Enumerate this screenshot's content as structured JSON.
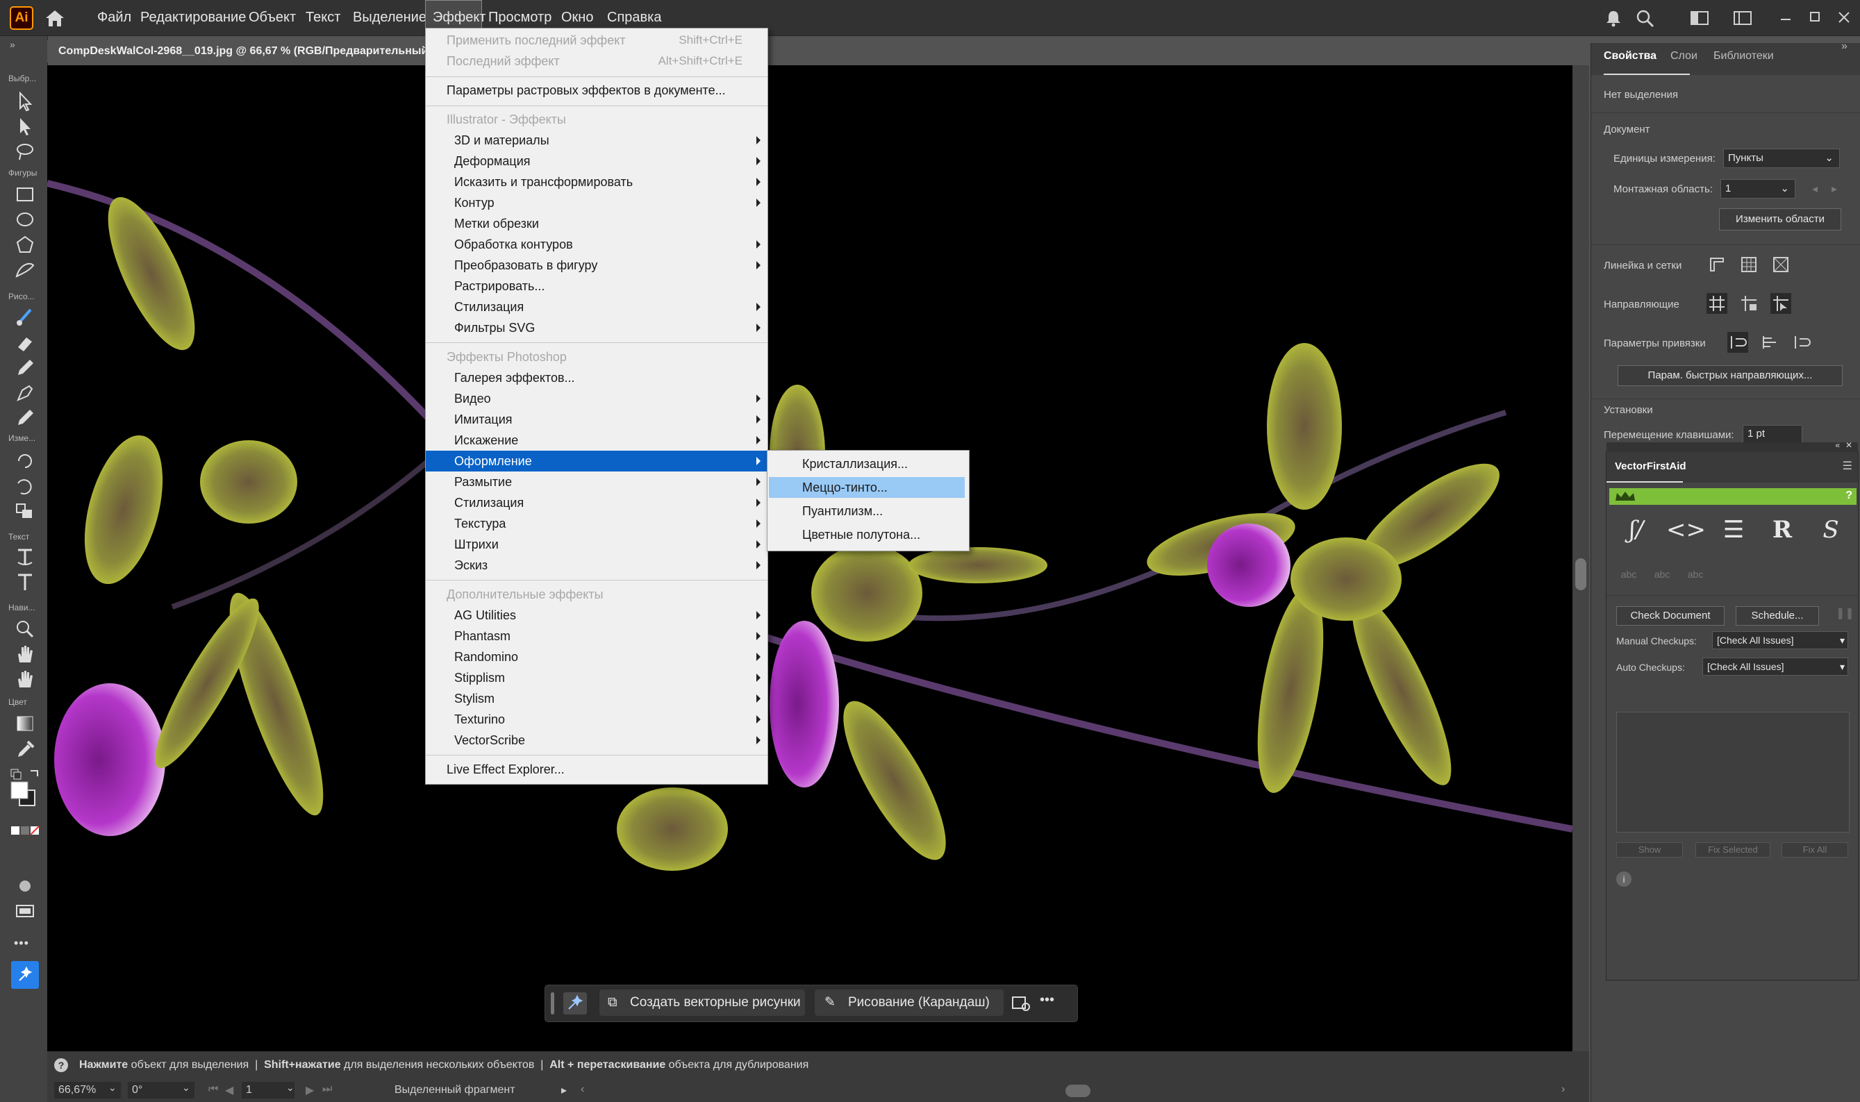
{
  "app": {
    "logo": "Ai"
  },
  "menubar": {
    "items": [
      "Файл",
      "Редактирование",
      "Объект",
      "Текст",
      "Выделение",
      "Эффект",
      "Просмотр",
      "Окно",
      "Справка"
    ]
  },
  "document": {
    "tab_title": "CompDeskWalCol-2968__019.jpg @ 66,67 % (RGB/Предварительный"
  },
  "toolbar": {
    "labels": [
      "Выбр...",
      "Фигуры",
      "Рисо...",
      "Изме...",
      "Текст",
      "Нави...",
      "Цвет"
    ],
    "more": "•••"
  },
  "effect_menu": {
    "top_items": [
      {
        "label": "Применить последний эффект",
        "shortcut": "Shift+Ctrl+E"
      },
      {
        "label": "Последний эффект",
        "shortcut": "Alt+Shift+Ctrl+E"
      },
      {
        "label": "Параметры растровых эффектов в документе..."
      }
    ],
    "illustrator_header": "Illustrator - Эффекты",
    "illustrator_items": [
      "3D и материалы",
      "Деформация",
      "Исказить и трансформировать",
      "Контур",
      "Метки обрезки",
      "Обработка контуров",
      "Преобразовать в фигуру",
      "Растрировать...",
      "Стилизация",
      "Фильтры SVG"
    ],
    "photoshop_header": "Эффекты Photoshop",
    "photoshop_items": [
      "Галерея эффектов...",
      "Видео",
      "Имитация",
      "Искажение",
      "Оформление",
      "Размытие",
      "Стилизация",
      "Текстура",
      "Штрихи",
      "Эскиз"
    ],
    "extra_header": "Дополнительные эффекты",
    "extra_items": [
      "AG Utilities",
      "Phantasm",
      "Randomino",
      "Stipplism",
      "Stylism",
      "Texturino",
      "VectorScribe"
    ],
    "bottom_item": "Live Effect Explorer..."
  },
  "submenu": {
    "items": [
      "Кристаллизация...",
      "Меццо-тинто...",
      "Пуантилизм...",
      "Цветные полутона..."
    ]
  },
  "taskbar": {
    "create_vector": "Создать векторные рисунки",
    "draw_pencil": "Рисование (Карандаш)",
    "more": "•••"
  },
  "status": {
    "hint_parts": [
      "Нажмите",
      " объект для выделения  |  ",
      "Shift+нажатие",
      " для выделения нескольких объектов  |  ",
      "Alt + перетаскивание",
      " объекта для дублирования"
    ],
    "zoom": "66,67%",
    "rotation": "0°",
    "artboard": "1",
    "selection": "Выделенный фрагмент"
  },
  "properties_panel": {
    "tabs": [
      "Свойства",
      "Слои",
      "Библиотеки"
    ],
    "no_selection": "Нет выделения",
    "document_label": "Документ",
    "units_label": "Единицы измерения:",
    "units_value": "Пункты",
    "artboard_label": "Монтажная область:",
    "artboard_value": "1",
    "edit_artboards": "Изменить области",
    "rulers_grids": "Линейка и сетки",
    "guides": "Направляющие",
    "snap_options": "Параметры привязки",
    "smart_guides_btn": "Парам. быстрых направляющих...",
    "preferences": "Установки",
    "keyboard_increment_label": "Перемещение клавишами:",
    "keyboard_increment_value": "1 pt"
  },
  "vfa_panel": {
    "title": "VectorFirstAid",
    "help": "?",
    "dim_labels": [
      "abc",
      "abc",
      "abc"
    ],
    "check_document": "Check Document",
    "schedule": "Schedule...",
    "manual_label": "Manual Checkups:",
    "manual_value": "[Check All Issues]",
    "auto_label": "Auto Checkups:",
    "auto_value": "[Check All Issues]",
    "show": "Show",
    "fix_selected": "Fix Selected",
    "fix_all": "Fix All",
    "info": "i"
  }
}
